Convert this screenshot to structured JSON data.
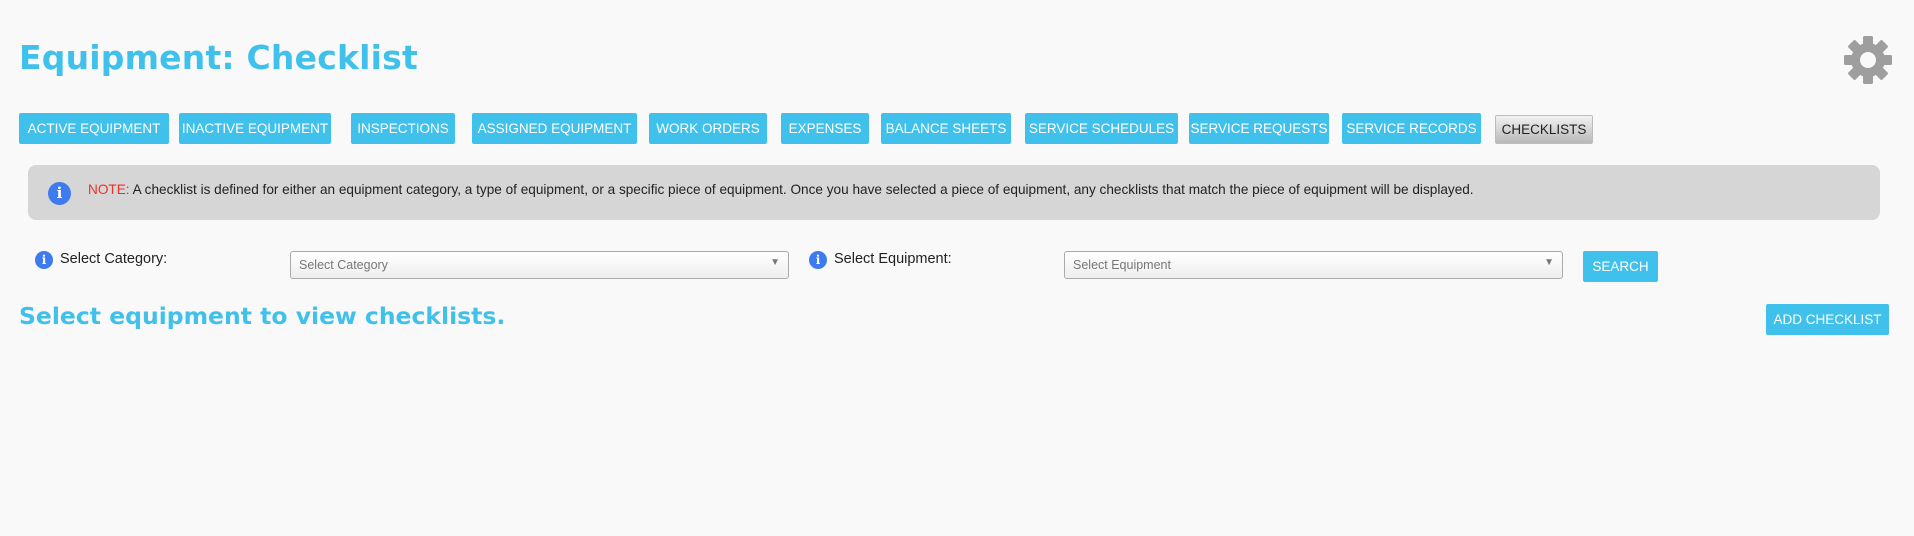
{
  "header": {
    "title": "Equipment: Checklist",
    "settings_icon": "gear-icon"
  },
  "tabs": [
    {
      "label": "Active Equipment"
    },
    {
      "label": "Inactive Equipment"
    },
    {
      "label": "Inspections"
    },
    {
      "label": "Assigned Equipment"
    },
    {
      "label": "Work Orders"
    },
    {
      "label": "Expenses"
    },
    {
      "label": "Balance Sheets"
    },
    {
      "label": "Service Schedules"
    },
    {
      "label": "Service Requests"
    },
    {
      "label": "Service Records"
    },
    {
      "label": "Checklists",
      "active": true
    }
  ],
  "note": {
    "label": "NOTE:",
    "text": " A checklist is defined for either an equipment category, a type of equipment, or a specific piece of equipment. Once you have selected a piece of equipment, any checklists that match the piece of equipment will be displayed."
  },
  "filters": {
    "category": {
      "label": "Select Category:",
      "placeholder": "Select Category"
    },
    "equipment": {
      "label": "Select Equipment:",
      "placeholder": "Select Equipment"
    },
    "search_label": "Search"
  },
  "main": {
    "empty_message": "Select equipment to view checklists.",
    "add_label": "Add Checklist"
  },
  "colors": {
    "accent": "#40c1ec",
    "note_background": "#d6d6d6",
    "note_label": "#e8332a",
    "info_icon": "#3d7bef",
    "gear": "#9e9e9e"
  }
}
